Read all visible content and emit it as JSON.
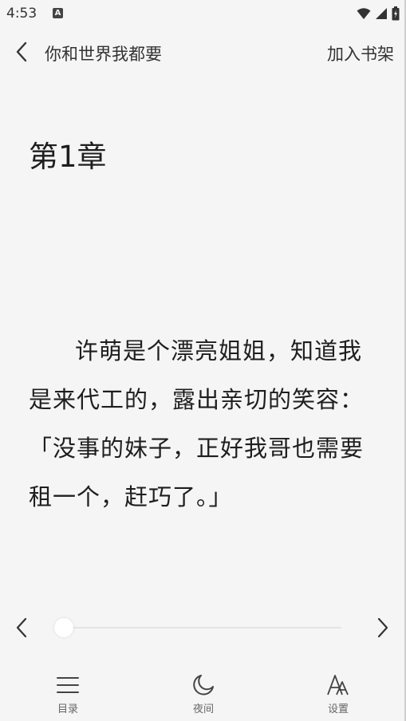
{
  "status_bar": {
    "time": "4:53",
    "badge": "A"
  },
  "header": {
    "back_icon": "chevron-left-icon",
    "title": "你和世界我都要",
    "shelf_label": "加入书架"
  },
  "reader": {
    "chapter_title": "第1章",
    "paragraph": "许萌是个漂亮姐姐，知道我是来代工的，露出亲切的笑容：「没事的妹子，正好我哥也需要租一个，赶巧了。」",
    "progress_percent": 0
  },
  "bottom_bar": {
    "items": [
      {
        "icon": "menu-icon",
        "label": "目录"
      },
      {
        "icon": "moon-icon",
        "label": "夜间"
      },
      {
        "icon": "font-icon",
        "label": "设置"
      }
    ]
  },
  "colors": {
    "background": "#f5f5f5",
    "text": "#1e1e1e",
    "muted": "#666666"
  }
}
